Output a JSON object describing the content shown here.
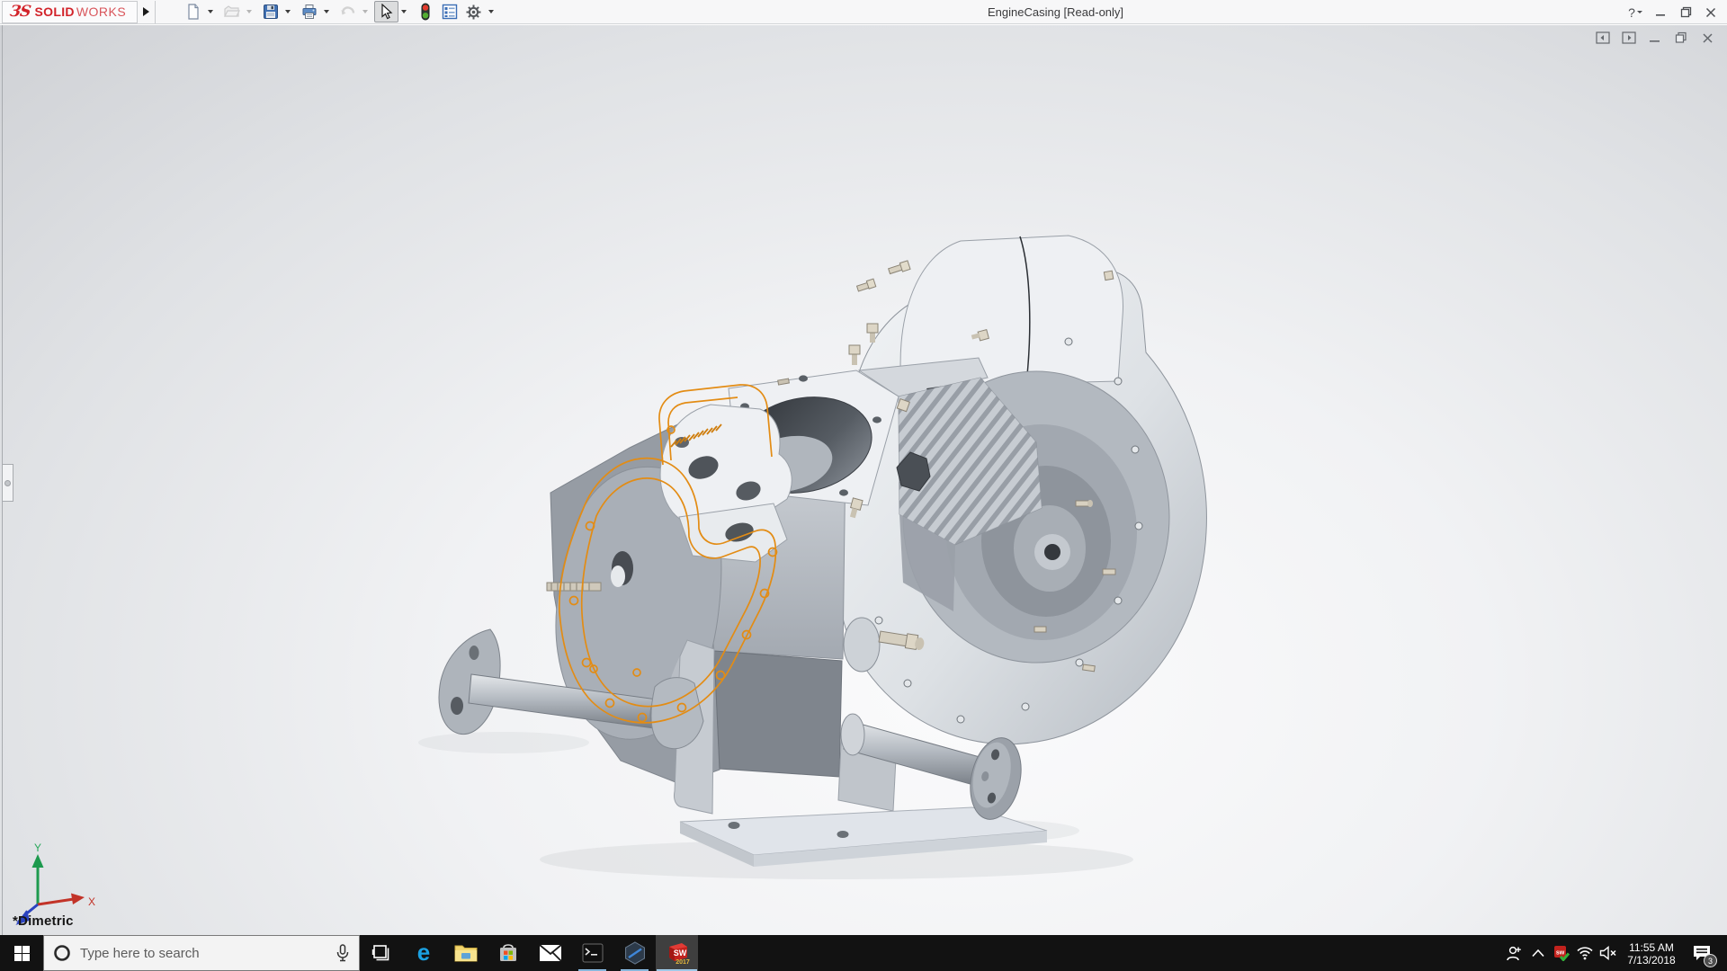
{
  "titlebar": {
    "brand": {
      "mark": "ЗS",
      "bold": "SOLID",
      "light": "WORKS"
    },
    "title": "EngineCasing [Read-only]",
    "help": "?"
  },
  "toolbar": {
    "items": [
      "new-document",
      "open",
      "save",
      "print",
      "undo",
      "select",
      "rebuild",
      "display-pane",
      "options"
    ]
  },
  "viewport": {
    "orientation": "*Dimetric",
    "triad": {
      "x": "X",
      "y": "Y"
    }
  },
  "model": {
    "part": "EngineCasing",
    "selection_color": "#E38C14",
    "body_color": "#C9CED4"
  },
  "taskbar": {
    "search": {
      "placeholder": "Type here to search"
    },
    "apps": [
      "task-view",
      "edge",
      "file-explorer",
      "store",
      "mail",
      "command-prompt",
      "composer",
      "solidworks-2017"
    ],
    "solidworks_badge": {
      "letters": "SW",
      "year": "2017"
    },
    "tray": {
      "time": "11:55 AM",
      "date": "7/13/2018",
      "badge": "3"
    }
  }
}
